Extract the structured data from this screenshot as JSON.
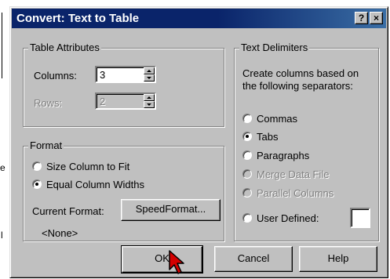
{
  "dialog": {
    "title": "Convert:  Text to Table",
    "help_btn": "?",
    "close_btn": "×"
  },
  "background_text": [
    "e",
    "l"
  ],
  "table_attributes": {
    "label": "Table Attributes",
    "columns_label": "Columns:",
    "columns_value": "3",
    "rows_label": "Rows:",
    "rows_value": "2"
  },
  "format": {
    "label": "Format",
    "options": [
      "Size Column to Fit",
      "Equal Column Widths"
    ],
    "selected": "Equal Column Widths",
    "current_format_label": "Current Format:",
    "speedformat_button": "SpeedFormat...",
    "current_format_value": "<None>"
  },
  "delimiters": {
    "label": "Text Delimiters",
    "description_line1": "Create columns based on",
    "description_line2": "the following separators:",
    "options": [
      "Commas",
      "Tabs",
      "Paragraphs",
      "Merge Data File",
      "Parallel Columns",
      "User Defined:"
    ],
    "disabled": [
      "Merge Data File",
      "Parallel Columns"
    ],
    "selected": "Tabs",
    "user_defined_value": ""
  },
  "buttons": {
    "ok": "OK",
    "cancel": "Cancel",
    "help": "Help"
  },
  "icons": {
    "help": "question-mark-icon",
    "close": "close-icon",
    "cursor": "mouse-pointer-icon",
    "spin_up": "spin-up-icon",
    "spin_down": "spin-down-icon"
  },
  "colors": {
    "titlebar": "#0a246a",
    "face": "#c0c0c0",
    "cursor": "#d40000"
  }
}
